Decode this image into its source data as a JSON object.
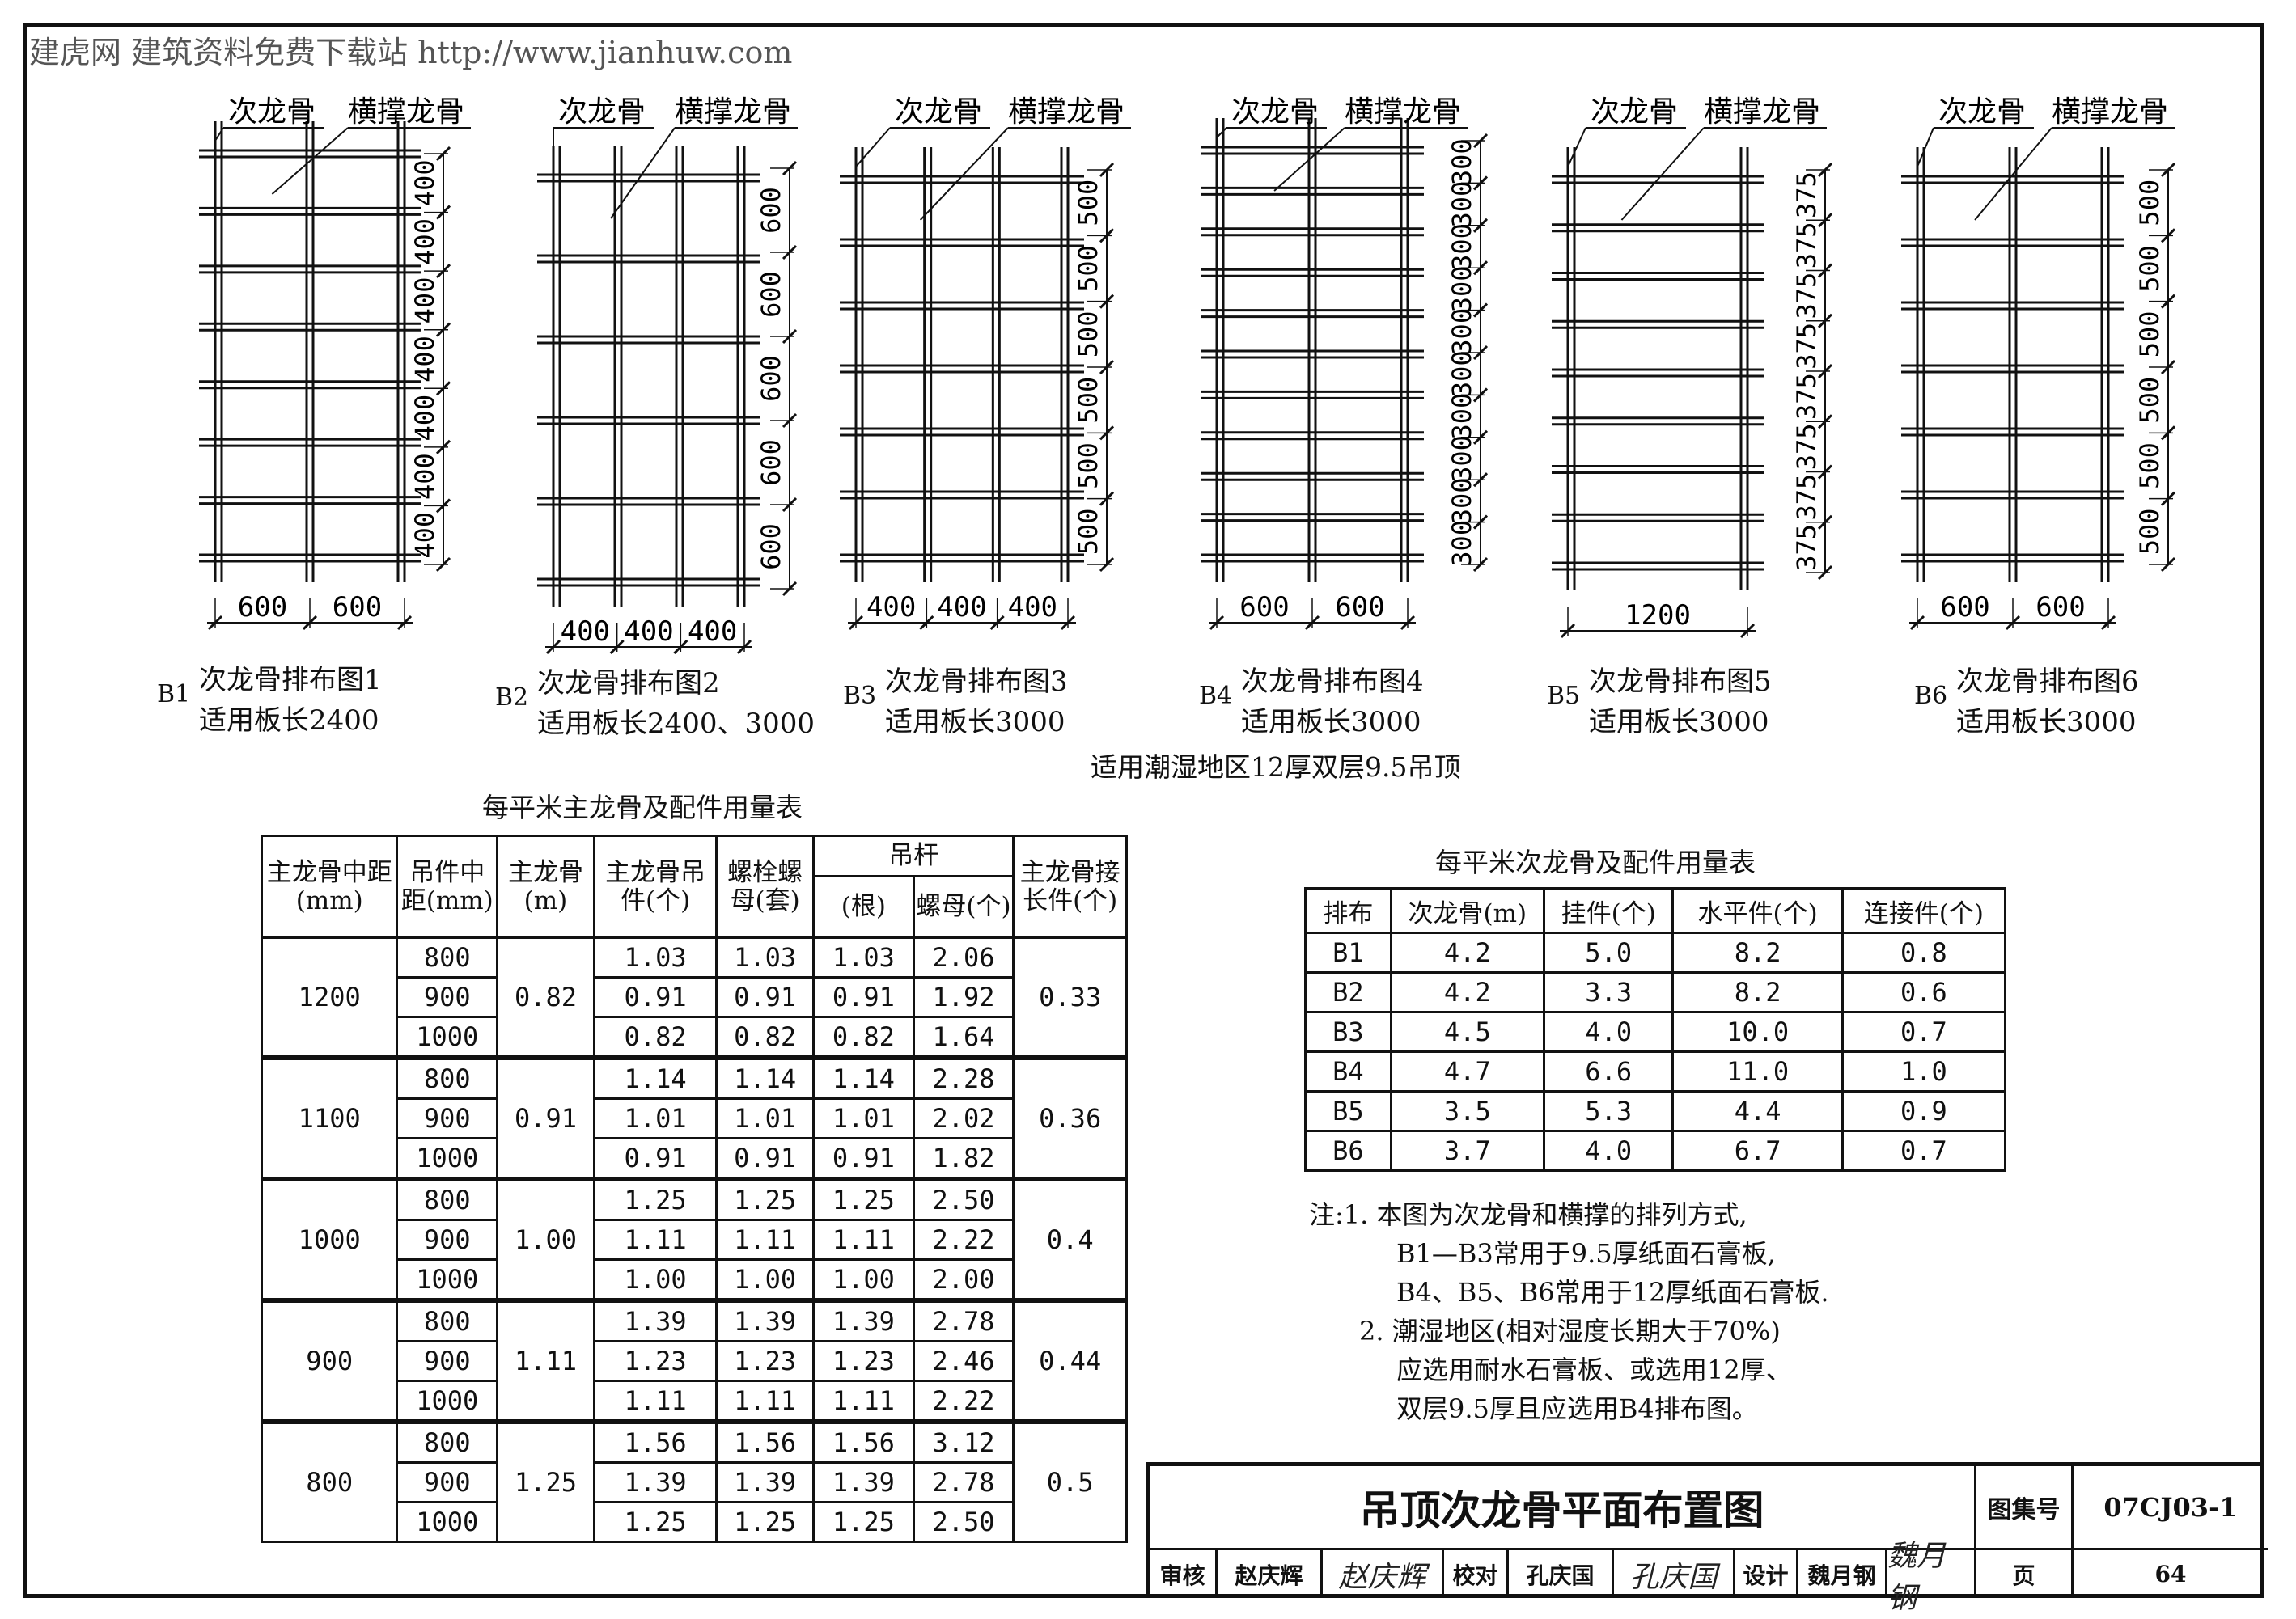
{
  "watermark_top": "建虎网 建筑资料免费下载站 http://www.jianhuw.com",
  "label_secondary": "次龙骨",
  "label_brace": "横撑龙骨",
  "diagrams": [
    {
      "code": "B1",
      "title": "次龙骨排布图1",
      "applies": "适用板长2400",
      "cols": 3,
      "rows": 8,
      "bottom_dims": [
        "600",
        "600"
      ],
      "side_dims": [
        "400",
        "400",
        "400",
        "400",
        "400",
        "400",
        "400"
      ]
    },
    {
      "code": "B2",
      "title": "次龙骨排布图2",
      "applies": "适用板长2400、3000",
      "cols": 4,
      "rows": 6,
      "bottom_dims": [
        "400",
        "400",
        "400"
      ],
      "side_dims": [
        "600",
        "600",
        "600",
        "600",
        "600"
      ]
    },
    {
      "code": "B3",
      "title": "次龙骨排布图3",
      "applies": "适用板长3000",
      "cols": 4,
      "rows": 7,
      "bottom_dims": [
        "400",
        "400",
        "400"
      ],
      "side_dims": [
        "500",
        "500",
        "500",
        "500",
        "500",
        "500"
      ]
    },
    {
      "code": "B4",
      "title": "次龙骨排布图4",
      "applies": "适用板长3000",
      "cols": 3,
      "rows": 11,
      "bottom_dims": [
        "600",
        "600"
      ],
      "side_dims": [
        "300",
        "300",
        "300",
        "300",
        "300",
        "300",
        "300",
        "300",
        "300",
        "300"
      ]
    },
    {
      "code": "B5",
      "title": "次龙骨排布图5",
      "applies": "适用板长3000",
      "cols": 2,
      "rows": 9,
      "bottom_dims": [
        "1200"
      ],
      "side_dims": [
        "375",
        "375",
        "375",
        "375",
        "375",
        "375",
        "375",
        "375"
      ]
    },
    {
      "code": "B6",
      "title": "次龙骨排布图6",
      "applies": "适用板长3000",
      "cols": 3,
      "rows": 7,
      "bottom_dims": [
        "600",
        "600"
      ],
      "side_dims": [
        "500",
        "500",
        "500",
        "500",
        "500",
        "500"
      ]
    }
  ],
  "moisture_note": "适用潮湿地区12厚双层9.5吊顶",
  "main_table": {
    "title": "每平米主龙骨及配件用量表",
    "headers": {
      "spacing": "主龙骨中距(mm)",
      "hanger_spacing": "吊件中距(mm)",
      "main": "主龙骨(m)",
      "hanger": "主龙骨吊件(个)",
      "bolt": "螺栓螺母(套)",
      "rod_group": "吊杆",
      "rod_count": "(根)",
      "rod_nut": "螺母(个)",
      "extension": "主龙骨接长件(个)"
    },
    "groups": [
      {
        "spacing": "1200",
        "main": "0.82",
        "ext": "0.33",
        "rows": [
          [
            "800",
            "1.03",
            "1.03",
            "1.03",
            "2.06"
          ],
          [
            "900",
            "0.91",
            "0.91",
            "0.91",
            "1.92"
          ],
          [
            "1000",
            "0.82",
            "0.82",
            "0.82",
            "1.64"
          ]
        ]
      },
      {
        "spacing": "1100",
        "main": "0.91",
        "ext": "0.36",
        "rows": [
          [
            "800",
            "1.14",
            "1.14",
            "1.14",
            "2.28"
          ],
          [
            "900",
            "1.01",
            "1.01",
            "1.01",
            "2.02"
          ],
          [
            "1000",
            "0.91",
            "0.91",
            "0.91",
            "1.82"
          ]
        ]
      },
      {
        "spacing": "1000",
        "main": "1.00",
        "ext": "0.4",
        "rows": [
          [
            "800",
            "1.25",
            "1.25",
            "1.25",
            "2.50"
          ],
          [
            "900",
            "1.11",
            "1.11",
            "1.11",
            "2.22"
          ],
          [
            "1000",
            "1.00",
            "1.00",
            "1.00",
            "2.00"
          ]
        ]
      },
      {
        "spacing": "900",
        "main": "1.11",
        "ext": "0.44",
        "rows": [
          [
            "800",
            "1.39",
            "1.39",
            "1.39",
            "2.78"
          ],
          [
            "900",
            "1.23",
            "1.23",
            "1.23",
            "2.46"
          ],
          [
            "1000",
            "1.11",
            "1.11",
            "1.11",
            "2.22"
          ]
        ]
      },
      {
        "spacing": "800",
        "main": "1.25",
        "ext": "0.5",
        "rows": [
          [
            "800",
            "1.56",
            "1.56",
            "1.56",
            "3.12"
          ],
          [
            "900",
            "1.39",
            "1.39",
            "1.39",
            "2.78"
          ],
          [
            "1000",
            "1.25",
            "1.25",
            "1.25",
            "2.50"
          ]
        ]
      }
    ]
  },
  "sec_table": {
    "title": "每平米次龙骨及配件用量表",
    "headers": [
      "排布",
      "次龙骨(m)",
      "挂件(个)",
      "水平件(个)",
      "连接件(个)"
    ],
    "rows": [
      [
        "B1",
        "4.2",
        "5.0",
        "8.2",
        "0.8"
      ],
      [
        "B2",
        "4.2",
        "3.3",
        "8.2",
        "0.6"
      ],
      [
        "B3",
        "4.5",
        "4.0",
        "10.0",
        "0.7"
      ],
      [
        "B4",
        "4.7",
        "6.6",
        "11.0",
        "1.0"
      ],
      [
        "B5",
        "3.5",
        "5.3",
        "4.4",
        "0.9"
      ],
      [
        "B6",
        "3.7",
        "4.0",
        "6.7",
        "0.7"
      ]
    ]
  },
  "notes": [
    "注:1. 本图为次龙骨和横撑的排列方式,",
    "B1—B3常用于9.5厚纸面石膏板,",
    "B4、B5、B6常用于12厚纸面石膏板.",
    "2. 潮湿地区(相对湿度长期大于70%)",
    "应选用耐水石膏板、或选用12厚、",
    "双层9.5厚且应选用B4排布图。"
  ],
  "title_block": {
    "title": "吊顶次龙骨平面布置图",
    "atlas_label": "图集号",
    "atlas_no": "07CJ03-1",
    "review_label": "审核",
    "reviewer": "赵庆辉",
    "reviewer_sig": "赵庆辉",
    "check_label": "校对",
    "checker": "孔庆国",
    "checker_sig": "孔庆国",
    "design_label": "设计",
    "designer": "魏月钢",
    "designer_sig": "魏月钢",
    "page_label": "页",
    "page_no": "64"
  }
}
